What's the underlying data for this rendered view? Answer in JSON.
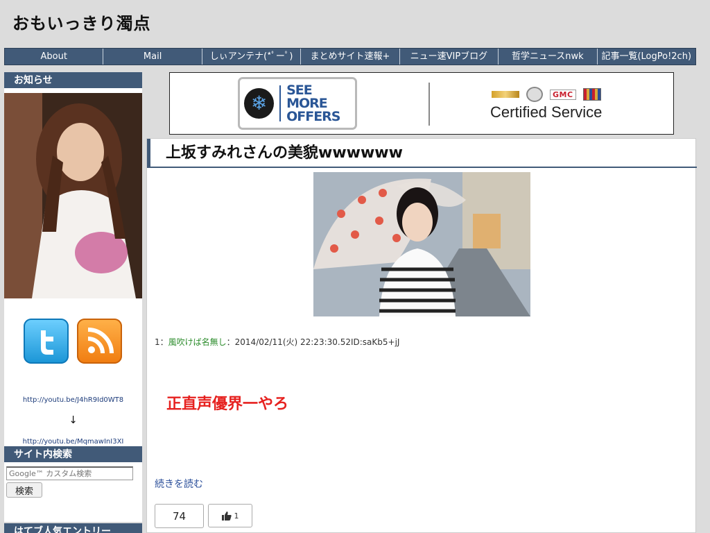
{
  "site": {
    "title": "おもいっきり濁点"
  },
  "nav": {
    "items": [
      {
        "label": "About"
      },
      {
        "label": "Mail"
      },
      {
        "label": "しぃアンテナ(*ﾟーﾟ)"
      },
      {
        "label": "まとめサイト速報+"
      },
      {
        "label": "ニュー速VIPブログ"
      },
      {
        "label": "哲学ニュースnwk"
      },
      {
        "label": "記事一覧(LogPo!2ch)"
      }
    ]
  },
  "sidebar": {
    "notice_title": "お知らせ",
    "link1": "http://youtu.be/J4hR9Id0WT8",
    "arrow": "↓",
    "link2": "http://youtu.be/MqmawInI3XI",
    "search_title": "サイト内検索",
    "search_placeholder": "Google™ カスタム検索",
    "search_button": "検索",
    "hatena_title": "はてブ人気エントリー"
  },
  "ad": {
    "offer_line1": "SEE MORE",
    "offer_line2": "OFFERS",
    "brand_gmc": "GMC",
    "certified": "Certified Service"
  },
  "post": {
    "title": "上坂すみれさんの美貌wwwwww",
    "meta_num": "1：",
    "meta_name": "風吹けば名無し",
    "meta_rest": "：2014/02/11(火) 22:23:30.52ID:saKb5+jJ",
    "body": "正直声優界一やろ",
    "read_more": "続きを読む",
    "share_count": "74",
    "like_count": "1"
  },
  "colors": {
    "nav_bg": "#415a78",
    "body_text_red": "#e6211f",
    "name_green": "#2c8c2c",
    "link_blue": "#2b4f9a"
  }
}
